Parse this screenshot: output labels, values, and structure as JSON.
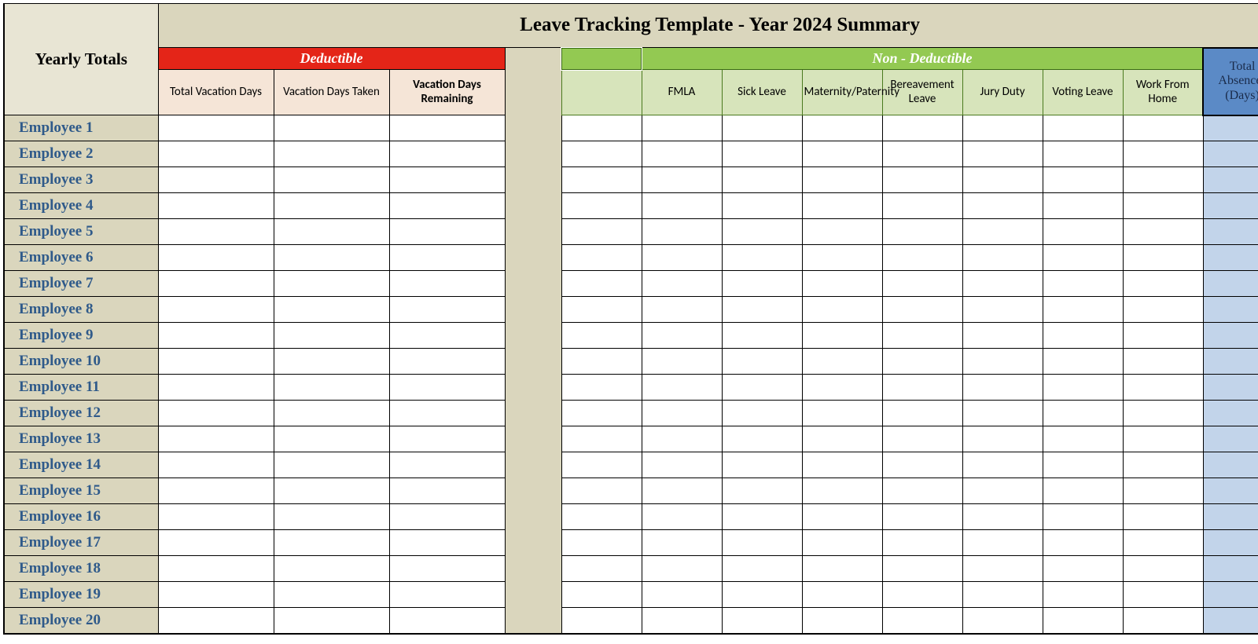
{
  "header": {
    "yearly_totals": "Yearly Totals",
    "title": "Leave Tracking Template - Year 2024 Summary",
    "deductible": "Deductible",
    "non_deductible": "Non - Deductible",
    "total_absences": "Total Absences (Days)"
  },
  "deductible_cols": {
    "total_vac": "Total Vacation Days",
    "vac_taken": "Vacation Days Taken",
    "vac_remain": "Vacation Days Remaining"
  },
  "nondeductible_cols": {
    "blank": "",
    "fmla": "FMLA",
    "sick": "Sick Leave",
    "maternity": "Maternity/Paternity",
    "bereave": "Bereavement Leave",
    "jury": "Jury Duty",
    "voting": "Voting Leave",
    "wfh": "Work From Home"
  },
  "rows": [
    {
      "name": "Employee 1",
      "tv": "",
      "vt": "",
      "vr": "",
      "b": "",
      "fmla": "",
      "sick": "",
      "mat": "",
      "ber": "",
      "jury": "",
      "vot": "",
      "wfh": "",
      "tot": ""
    },
    {
      "name": "Employee 2",
      "tv": "",
      "vt": "",
      "vr": "",
      "b": "",
      "fmla": "",
      "sick": "",
      "mat": "",
      "ber": "",
      "jury": "",
      "vot": "",
      "wfh": "",
      "tot": ""
    },
    {
      "name": "Employee 3",
      "tv": "",
      "vt": "",
      "vr": "",
      "b": "",
      "fmla": "",
      "sick": "",
      "mat": "",
      "ber": "",
      "jury": "",
      "vot": "",
      "wfh": "",
      "tot": ""
    },
    {
      "name": "Employee 4",
      "tv": "",
      "vt": "",
      "vr": "",
      "b": "",
      "fmla": "",
      "sick": "",
      "mat": "",
      "ber": "",
      "jury": "",
      "vot": "",
      "wfh": "",
      "tot": ""
    },
    {
      "name": "Employee 5",
      "tv": "",
      "vt": "",
      "vr": "",
      "b": "",
      "fmla": "",
      "sick": "",
      "mat": "",
      "ber": "",
      "jury": "",
      "vot": "",
      "wfh": "",
      "tot": ""
    },
    {
      "name": "Employee 6",
      "tv": "",
      "vt": "",
      "vr": "",
      "b": "",
      "fmla": "",
      "sick": "",
      "mat": "",
      "ber": "",
      "jury": "",
      "vot": "",
      "wfh": "",
      "tot": ""
    },
    {
      "name": "Employee 7",
      "tv": "",
      "vt": "",
      "vr": "",
      "b": "",
      "fmla": "",
      "sick": "",
      "mat": "",
      "ber": "",
      "jury": "",
      "vot": "",
      "wfh": "",
      "tot": ""
    },
    {
      "name": "Employee 8",
      "tv": "",
      "vt": "",
      "vr": "",
      "b": "",
      "fmla": "",
      "sick": "",
      "mat": "",
      "ber": "",
      "jury": "",
      "vot": "",
      "wfh": "",
      "tot": ""
    },
    {
      "name": "Employee 9",
      "tv": "",
      "vt": "",
      "vr": "",
      "b": "",
      "fmla": "",
      "sick": "",
      "mat": "",
      "ber": "",
      "jury": "",
      "vot": "",
      "wfh": "",
      "tot": ""
    },
    {
      "name": "Employee 10",
      "tv": "",
      "vt": "",
      "vr": "",
      "b": "",
      "fmla": "",
      "sick": "",
      "mat": "",
      "ber": "",
      "jury": "",
      "vot": "",
      "wfh": "",
      "tot": ""
    },
    {
      "name": "Employee 11",
      "tv": "",
      "vt": "",
      "vr": "",
      "b": "",
      "fmla": "",
      "sick": "",
      "mat": "",
      "ber": "",
      "jury": "",
      "vot": "",
      "wfh": "",
      "tot": ""
    },
    {
      "name": "Employee 12",
      "tv": "",
      "vt": "",
      "vr": "",
      "b": "",
      "fmla": "",
      "sick": "",
      "mat": "",
      "ber": "",
      "jury": "",
      "vot": "",
      "wfh": "",
      "tot": ""
    },
    {
      "name": "Employee 13",
      "tv": "",
      "vt": "",
      "vr": "",
      "b": "",
      "fmla": "",
      "sick": "",
      "mat": "",
      "ber": "",
      "jury": "",
      "vot": "",
      "wfh": "",
      "tot": ""
    },
    {
      "name": "Employee 14",
      "tv": "",
      "vt": "",
      "vr": "",
      "b": "",
      "fmla": "",
      "sick": "",
      "mat": "",
      "ber": "",
      "jury": "",
      "vot": "",
      "wfh": "",
      "tot": ""
    },
    {
      "name": "Employee 15",
      "tv": "",
      "vt": "",
      "vr": "",
      "b": "",
      "fmla": "",
      "sick": "",
      "mat": "",
      "ber": "",
      "jury": "",
      "vot": "",
      "wfh": "",
      "tot": ""
    },
    {
      "name": "Employee 16",
      "tv": "",
      "vt": "",
      "vr": "",
      "b": "",
      "fmla": "",
      "sick": "",
      "mat": "",
      "ber": "",
      "jury": "",
      "vot": "",
      "wfh": "",
      "tot": ""
    },
    {
      "name": "Employee 17",
      "tv": "",
      "vt": "",
      "vr": "",
      "b": "",
      "fmla": "",
      "sick": "",
      "mat": "",
      "ber": "",
      "jury": "",
      "vot": "",
      "wfh": "",
      "tot": ""
    },
    {
      "name": "Employee 18",
      "tv": "",
      "vt": "",
      "vr": "",
      "b": "",
      "fmla": "",
      "sick": "",
      "mat": "",
      "ber": "",
      "jury": "",
      "vot": "",
      "wfh": "",
      "tot": ""
    },
    {
      "name": "Employee 19",
      "tv": "",
      "vt": "",
      "vr": "",
      "b": "",
      "fmla": "",
      "sick": "",
      "mat": "",
      "ber": "",
      "jury": "",
      "vot": "",
      "wfh": "",
      "tot": ""
    },
    {
      "name": "Employee 20",
      "tv": "",
      "vt": "",
      "vr": "",
      "b": "",
      "fmla": "",
      "sick": "",
      "mat": "",
      "ber": "",
      "jury": "",
      "vot": "",
      "wfh": "",
      "tot": ""
    }
  ]
}
